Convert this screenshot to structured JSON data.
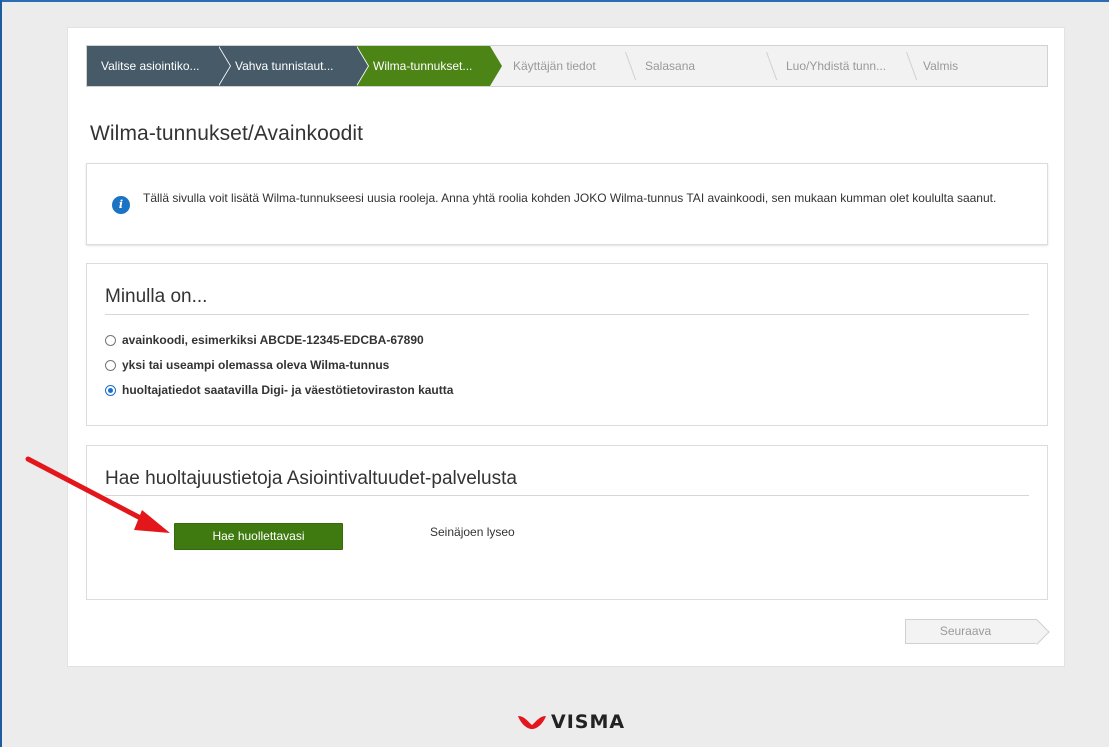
{
  "stepper": {
    "steps": [
      {
        "label": "Valitse asiointiko...",
        "state": "done"
      },
      {
        "label": "Vahva tunnistaut...",
        "state": "done"
      },
      {
        "label": "Wilma-tunnukset...",
        "state": "active"
      },
      {
        "label": "Käyttäjän tiedot",
        "state": "todo"
      },
      {
        "label": "Salasana",
        "state": "todo"
      },
      {
        "label": "Luo/Yhdistä tunn...",
        "state": "todo"
      },
      {
        "label": "Valmis",
        "state": "todo"
      }
    ]
  },
  "page": {
    "title": "Wilma-tunnukset/Avainkoodit"
  },
  "info": {
    "icon": "info-icon",
    "text": "Tällä sivulla voit lisätä Wilma-tunnukseesi uusia rooleja. Anna yhtä roolia kohden JOKO Wilma-tunnus TAI avainkoodi, sen mukaan kumman olet koululta saanut."
  },
  "choice": {
    "title": "Minulla on...",
    "options": [
      {
        "label": "avainkoodi, esimerkiksi ABCDE-12345-EDCBA-67890",
        "checked": false
      },
      {
        "label": "yksi tai useampi olemassa oleva Wilma-tunnus",
        "checked": false
      },
      {
        "label": "huoltajatiedot saatavilla Digi- ja väestötietoviraston kautta",
        "checked": true
      }
    ]
  },
  "fetch": {
    "title": "Hae huoltajuustietoja Asiointivaltuudet-palvelusta",
    "button_label": "Hae huollettavasi",
    "school": "Seinäjoen lyseo"
  },
  "footer": {
    "next_label": "Seuraava",
    "logo_text": "VISMA"
  },
  "colors": {
    "step_done": "#465a68",
    "step_active": "#4c8416",
    "button_green": "#3f7a10",
    "info_blue": "#1b73c4",
    "arrow_red": "#e3161b",
    "visma_red": "#e3161b"
  }
}
